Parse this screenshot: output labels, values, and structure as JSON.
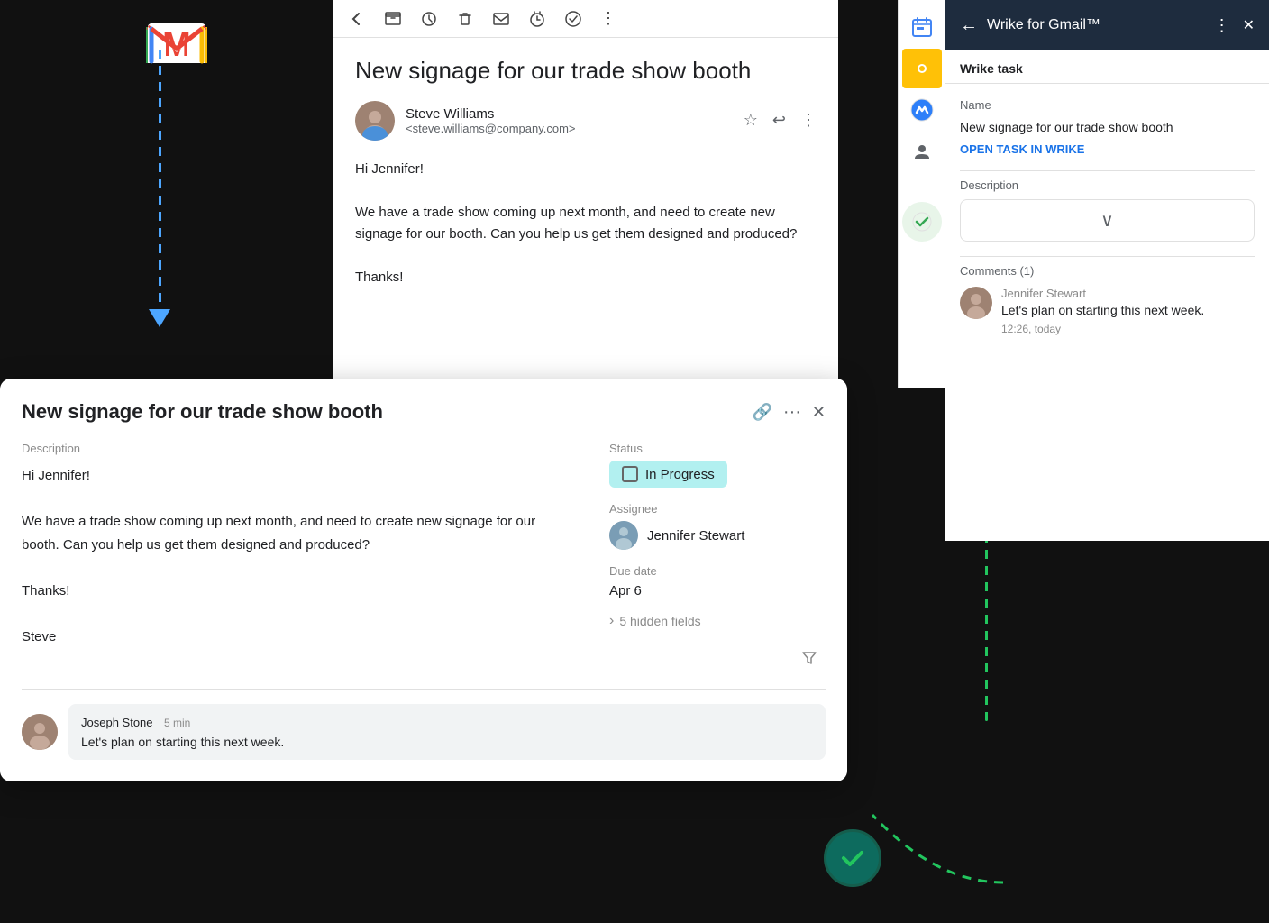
{
  "app": {
    "title": "Wrike for Gmail™"
  },
  "gmail": {
    "email_subject": "New signage for our trade show booth",
    "sender_name": "Steve Williams",
    "sender_email": "<steve.williams@company.com>",
    "email_body_line1": "Hi Jennifer!",
    "email_body_line2": "We have a trade show coming up next month, and need to create new signage for our booth. Can you help us get them designed and produced?",
    "email_body_line3": "Thanks!"
  },
  "wrike_panel": {
    "header_title": "Wrike for Gmail™",
    "wrike_task_label": "Wrike task",
    "name_label": "Name",
    "task_name": "New signage for our trade show booth",
    "open_task_link": "OPEN TASK IN WRIKE",
    "description_label": "Description",
    "comments_label": "Comments (1)",
    "comment_author": "Jennifer Stewart",
    "comment_text": "Let's plan on starting this next week.",
    "comment_time": "12:26, today"
  },
  "task_modal": {
    "title": "New signage for our trade show booth",
    "description_label": "Description",
    "body_line1": "Hi Jennifer!",
    "body_line2": "We have a trade show coming up next month, and need to create new signage for our booth. Can you help us get them designed and produced?",
    "body_line3": "Thanks!",
    "body_line4": "Steve",
    "status_label": "Status",
    "status_value": "In Progress",
    "assignee_label": "Assignee",
    "assignee_name": "Jennifer Stewart",
    "due_date_label": "Due date",
    "due_date_value": "Apr 6",
    "hidden_fields": "5 hidden fields",
    "comment_author": "Joseph Stone",
    "comment_time": "5 min",
    "comment_text": "Let's plan on starting this next week."
  },
  "icons": {
    "back": "←",
    "more_vert": "⋮",
    "close": "✕",
    "star": "☆",
    "reply": "↩",
    "link": "🔗",
    "chevron_down": "∨",
    "filter": "⊳",
    "archive": "⬜",
    "snooze": "⏱",
    "delete": "🗑",
    "forward": "✉",
    "schedule": "⏰",
    "task_add": "✔",
    "expand": "›"
  }
}
